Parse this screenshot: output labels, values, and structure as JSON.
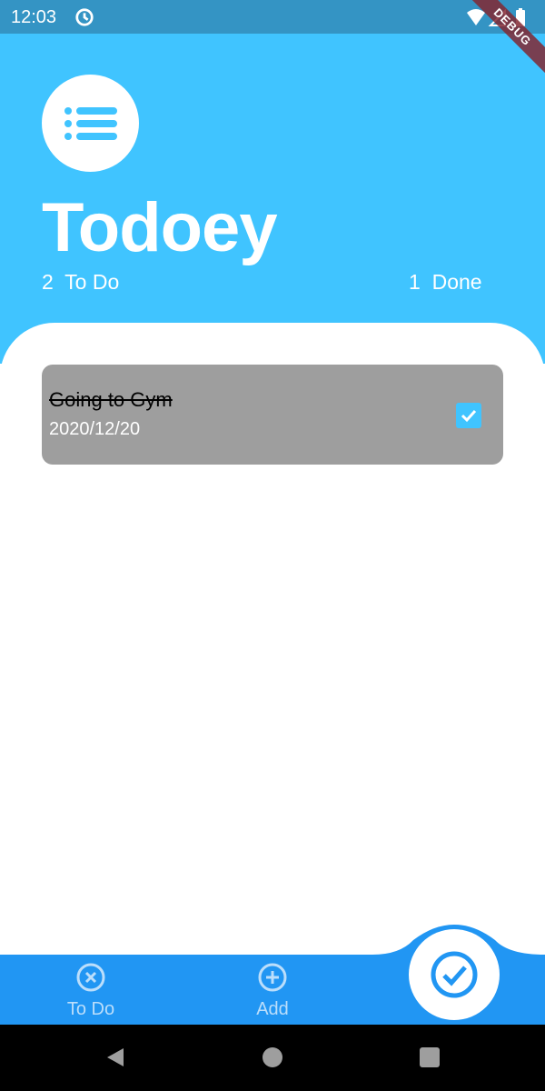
{
  "status_bar": {
    "time": "12:03",
    "icons": [
      "sync-icon",
      "wifi-icon",
      "signal-icon",
      "battery-icon"
    ]
  },
  "debug_banner": "DEBUG",
  "header": {
    "title": "Todoey",
    "todo_count": "2",
    "todo_label": "To Do",
    "done_count": "1",
    "done_label": "Done",
    "logo_icon": "list-icon"
  },
  "tasks": [
    {
      "title": "Going to Gym",
      "date": "2020/12/20",
      "done": true
    }
  ],
  "bottom_nav": {
    "items": [
      {
        "label": "To Do",
        "icon": "close-circle-icon"
      },
      {
        "label": "Add",
        "icon": "add-circle-icon"
      }
    ],
    "fab_icon": "check-circle-icon"
  },
  "colors": {
    "header": "#40c4ff",
    "status_bar": "#3494c4",
    "bottom_bar": "#2196f3",
    "task_card": "#9e9e9e",
    "checkbox": "#40c4ff"
  }
}
